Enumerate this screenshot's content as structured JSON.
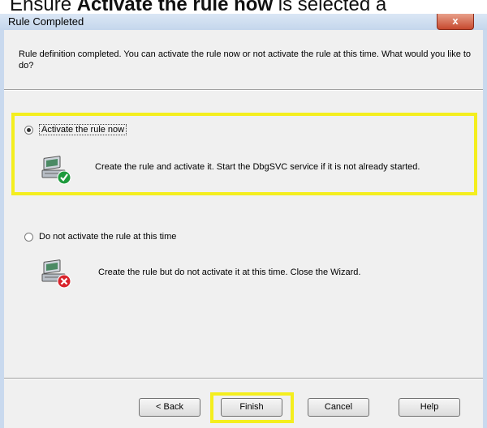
{
  "caption": {
    "before": "Ensure ",
    "bold": "Activate the rule now",
    "after": " is selected a"
  },
  "window": {
    "title": "Rule Completed",
    "close_glyph": "x"
  },
  "intro": "Rule definition completed. You can activate the rule now or not activate the rule at this time. What would you like to do?",
  "options": [
    {
      "label": "Activate the rule now",
      "selected": true,
      "description": "Create the rule and activate it. Start the DbgSVC service if it is not already started.",
      "icon": "computer-checkmark-icon"
    },
    {
      "label": "Do not activate the rule at this time",
      "selected": false,
      "description": "Create the rule but do not activate it at this time. Close the Wizard.",
      "icon": "computer-cross-icon"
    }
  ],
  "buttons": {
    "back": "< Back",
    "finish": "Finish",
    "cancel": "Cancel",
    "help": "Help"
  },
  "colors": {
    "highlight": "#f4ee1e",
    "title_bar": "#c4d6ec",
    "close_button": "#c6492f",
    "dialog_background": "#f0f0f0"
  }
}
